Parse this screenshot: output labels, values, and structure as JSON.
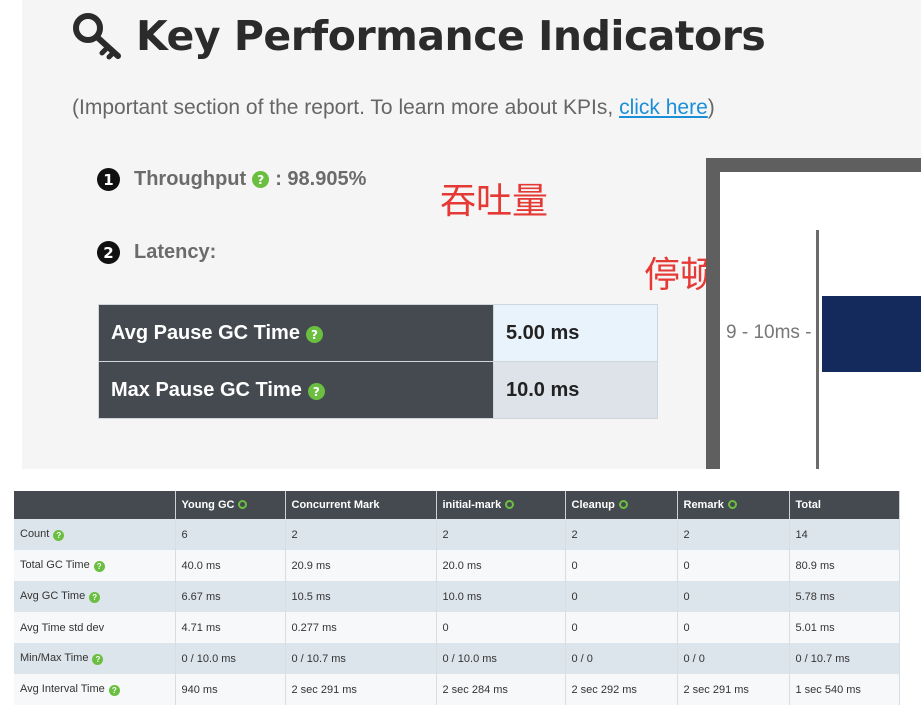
{
  "header": {
    "title": "Key Performance Indicators",
    "subtitle_prefix": "(Important section of the report. To learn more about KPIs, ",
    "subtitle_link": "click here",
    "subtitle_suffix": ")"
  },
  "kpis": {
    "throughput": {
      "number": "1",
      "label": "Throughput",
      "help": "?",
      "value": ": 98.905%"
    },
    "latency": {
      "number": "2",
      "label": "Latency:"
    }
  },
  "annotations": {
    "throughput": "吞吐量",
    "latency": "停顿时间"
  },
  "latency_table": [
    {
      "label": "Avg Pause GC Time",
      "value": "5.00 ms"
    },
    {
      "label": "Max Pause GC Time",
      "value": "10.0 ms"
    }
  ],
  "chart": {
    "tick_label": "9 - 10ms -"
  },
  "gc_table": {
    "headers": [
      "",
      "Young GC",
      "Concurrent Mark",
      "initial-mark",
      "Cleanup",
      "Remark",
      "Total"
    ],
    "rows": [
      {
        "label": "Count",
        "cells": [
          "6",
          "2",
          "2",
          "2",
          "2",
          "14"
        ]
      },
      {
        "label": "Total GC Time",
        "cells": [
          "40.0 ms",
          "20.9 ms",
          "20.0 ms",
          "0",
          "0",
          "80.9 ms"
        ]
      },
      {
        "label": "Avg GC Time",
        "cells": [
          "6.67 ms",
          "10.5 ms",
          "10.0 ms",
          "0",
          "0",
          "5.78 ms"
        ]
      },
      {
        "label": "Avg Time std dev",
        "cells": [
          "4.71 ms",
          "0.277 ms",
          "0",
          "0",
          "0",
          "5.01 ms"
        ]
      },
      {
        "label": "Min/Max Time",
        "cells": [
          "0 / 10.0 ms",
          "0 / 10.7 ms",
          "0 / 10.0 ms",
          "0 / 0",
          "0 / 0",
          "0 / 10.7 ms"
        ]
      },
      {
        "label": "Avg Interval Time",
        "cells": [
          "940 ms",
          "2 sec 291 ms",
          "2 sec 284 ms",
          "2 sec 292 ms",
          "2 sec 291 ms",
          "1 sec 540 ms"
        ]
      }
    ]
  },
  "colors": {
    "accent_green": "#6abf40",
    "header_dark": "#444a50",
    "annotation_red": "#e53935",
    "link_blue": "#1a8fd8",
    "chart_bar": "#142a5c"
  },
  "icons": {
    "title_icon": "key-icon",
    "help_icon": "question-circle-icon",
    "header_marker": "circle-outline-icon"
  }
}
